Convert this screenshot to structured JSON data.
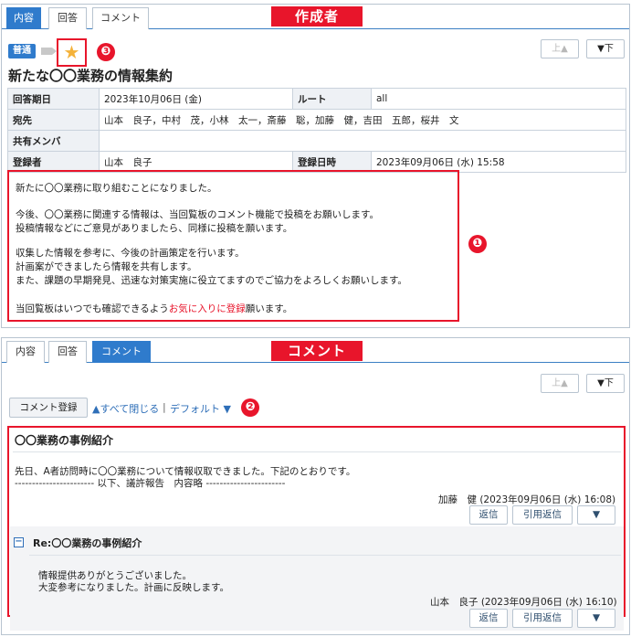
{
  "top": {
    "tabs": [
      "内容",
      "回答",
      "コメント"
    ],
    "banner": "作成者",
    "nav_up": "上▲",
    "nav_down": "▼下",
    "priority": "普通",
    "star_icon": "★",
    "markers": [
      "❶",
      "❷",
      "❸"
    ],
    "title": "新たな〇〇業務の情報集約",
    "info": {
      "due_label": "回答期日",
      "due_value": "2023年10月06日 (金)",
      "route_label": "ルート",
      "route_value": "all",
      "to_label": "宛先",
      "to_value": "山本　良子，中村　茂，小林　太一，斎藤　聡，加藤　健，吉田　五郎，桜井　文",
      "members_label": "共有メンバ",
      "members_value": "",
      "registrant_label": "登録者",
      "registrant_value": "山本　良子",
      "regdate_label": "登録日時",
      "regdate_value": "2023年09月06日 (水) 15:58"
    },
    "body": {
      "line1": "新たに〇〇業務に取り組むことになりました。",
      "line2": "今後、〇〇業務に関連する情報は、当回覧板のコメント機能で投稿をお願いします。",
      "line3": "投稿情報などにご意見がありましたら、同様に投稿を願います。",
      "line4": "収集した情報を参考に、今後の計画策定を行います。",
      "line5": "計画案ができましたら情報を共有します。",
      "line6": "また、課題の早期発見、迅速な対策実施に役立てますのでご協力をよろしくお願いします。",
      "line7_a": "当回覧板はいつでも確認できるよう",
      "line7_hl": "お気に入りに登録",
      "line7_b": "願います。"
    }
  },
  "bottom": {
    "tabs": [
      "内容",
      "回答",
      "コメント"
    ],
    "banner": "コメント",
    "nav_up": "上▲",
    "nav_down": "▼下",
    "register_button": "コメント登録",
    "close_all": "▲すべて閉じる",
    "separator": "|",
    "default_link": "デフォルト ▼",
    "comment": {
      "title": "〇〇業務の事例紹介",
      "line1": "先日、A者訪問時に〇〇業務について情報収取できました。下記のとおりです。",
      "line2": "----------------------- 以下、議許報告　内容略 -----------------------",
      "author": "加藤　健 (2023年09月06日 (水) 16:08)",
      "reply_btn": "返信",
      "quote_btn": "引用返信",
      "more_btn": "▼"
    },
    "reply": {
      "collapse_icon": "−",
      "title": "Re:〇〇業務の事例紹介",
      "line1": "情報提供ありがとうございました。",
      "line2": "大変参考になりました。計画に反映します。",
      "author": "山本　良子 (2023年09月06日 (水) 16:10)",
      "reply_btn": "返信",
      "quote_btn": "引用返信",
      "more_btn": "▼"
    }
  },
  "colors": {
    "accent": "#2f7bcc",
    "highlight": "#e8152b",
    "star": "#f4b23a"
  }
}
